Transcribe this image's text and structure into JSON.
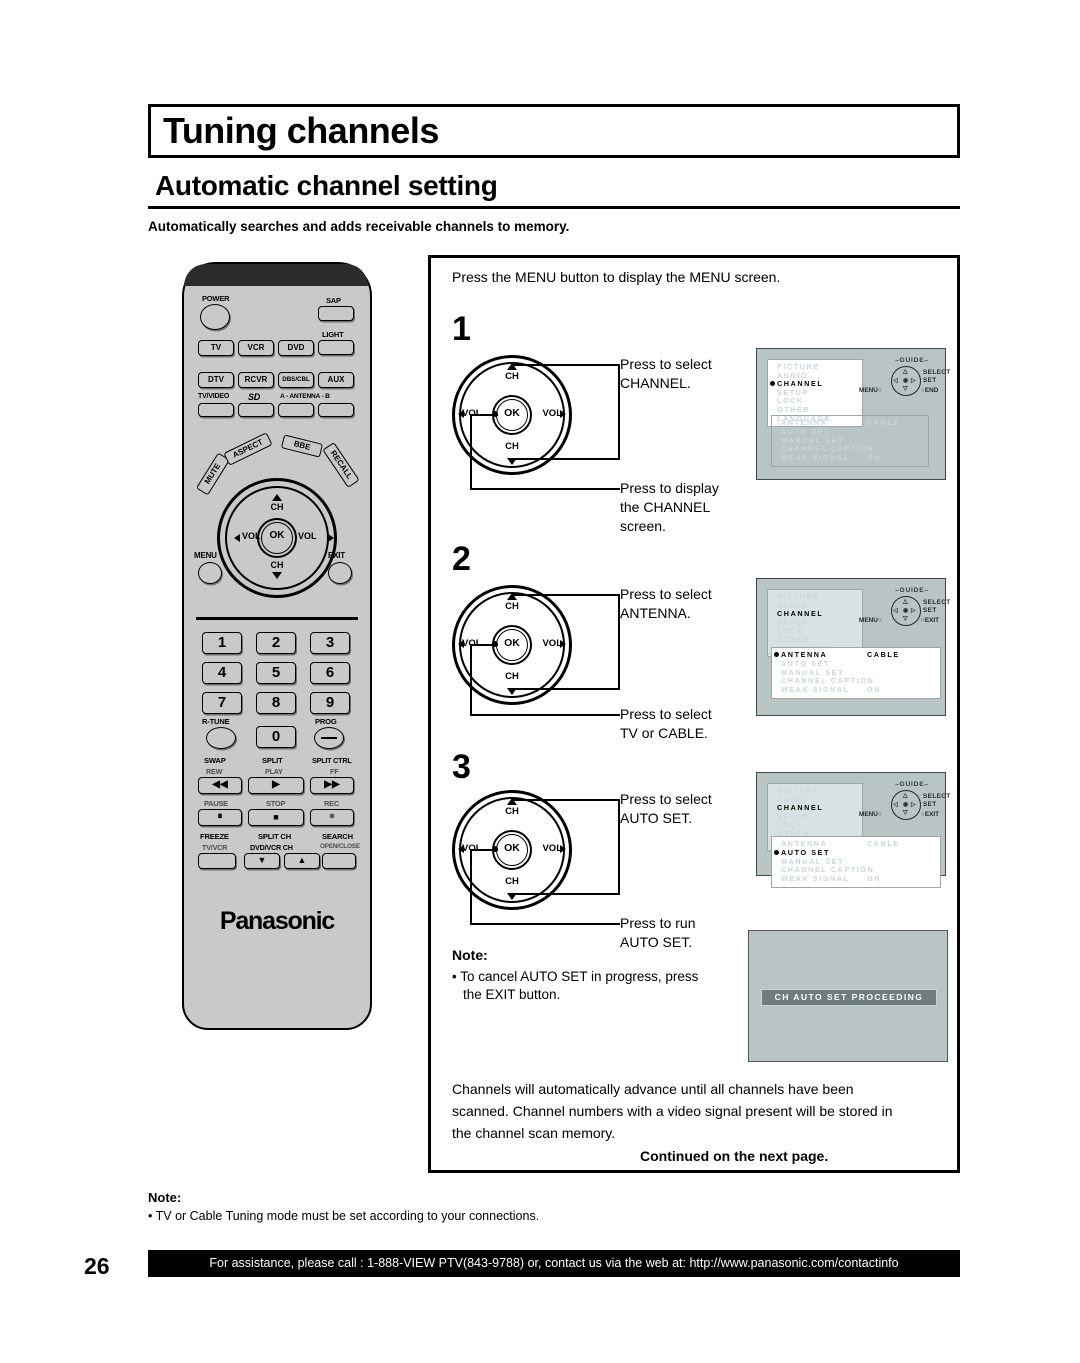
{
  "header": {
    "title": "Tuning channels",
    "subtitle": "Automatic channel setting",
    "intro": "Automatically searches and adds receivable channels to memory."
  },
  "content": {
    "lead": "Press the MENU button to display the MENU screen.",
    "steps": [
      {
        "number": "1",
        "callout_top_line1": "Press to select",
        "callout_top_line2": "CHANNEL.",
        "callout_bottom_line1": "Press to display",
        "callout_bottom_line2": "the CHANNEL",
        "callout_bottom_line3": "screen."
      },
      {
        "number": "2",
        "callout_top_line1": "Press to select",
        "callout_top_line2": "ANTENNA.",
        "callout_bottom_line1": "Press to select",
        "callout_bottom_line2": "TV or CABLE."
      },
      {
        "number": "3",
        "callout_top_line1": "Press to select",
        "callout_top_line2": "AUTO SET.",
        "callout_bottom_line1": "Press to run",
        "callout_bottom_line2": "AUTO SET."
      }
    ],
    "note": {
      "title": "Note:",
      "bullet_line1": "To cancel AUTO SET in progress, press",
      "bullet_line2": "the EXIT button."
    },
    "closing_line1": "Channels will automatically advance until all channels have been",
    "closing_line2": "scanned. Channel numbers with a video signal present will be stored in",
    "closing_line3": "the channel scan memory.",
    "continued": "Continued on the next page."
  },
  "osd": {
    "guide": {
      "header": "–GUIDE–",
      "select": "SELECT",
      "set": "SET",
      "menu": "MENU○",
      "end": "○END",
      "exit": "○EXIT"
    },
    "main_menu": [
      "PICTURE",
      "AUDIO",
      "CHANNEL",
      "SETUP",
      "LOCK",
      "OTHER",
      "LANGUAGE"
    ],
    "submenu": [
      {
        "label": "ANTENNA",
        "value": "CABLE"
      },
      {
        "label": "AUTO SET",
        "value": ""
      },
      {
        "label": "MANUAL SET",
        "value": ""
      },
      {
        "label": "CHANNEL CAPTION",
        "value": ""
      },
      {
        "label": "WEAK SIGNAL",
        "value": "ON"
      }
    ],
    "screens": [
      {
        "selected_main": "CHANNEL",
        "selected_sub": "",
        "guide_right": "○END"
      },
      {
        "selected_main": "CHANNEL",
        "selected_sub": "ANTENNA",
        "guide_right": "○EXIT"
      },
      {
        "selected_main": "CHANNEL",
        "selected_sub": "AUTO SET",
        "guide_right": "○EXIT"
      }
    ],
    "proceeding_message": "CH AUTO SET PROCEEDING"
  },
  "remote": {
    "brand": "Panasonic",
    "power_label": "POWER",
    "sap_label": "SAP",
    "light_label": "LIGHT",
    "device_row1": [
      "TV",
      "VCR",
      "DVD"
    ],
    "device_row2": [
      "DTV",
      "RCVR",
      "DBS/CBL",
      "AUX"
    ],
    "tvvideo_label": "TV/VIDEO",
    "sd_label": "SD",
    "antenna_label": "A - ANTENNA - B",
    "arc_buttons": [
      "MUTE",
      "ASPECT",
      "BBE",
      "RECALL"
    ],
    "dial": {
      "ch_up": "CH",
      "ch_down": "CH",
      "vol_left": "VOL",
      "vol_right": "VOL",
      "ok": "OK"
    },
    "menu_label": "MENU",
    "exit_label": "EXIT",
    "keypad": [
      "1",
      "2",
      "3",
      "4",
      "5",
      "6",
      "7",
      "8",
      "9",
      "0"
    ],
    "rtune_label": "R-TUNE",
    "prog_label": "PROG",
    "transport": {
      "swap": "SWAP",
      "rew": "REW",
      "split": "SPLIT",
      "play": "PLAY",
      "split_ctrl": "SPLIT CTRL",
      "ff": "FF",
      "pause": "PAUSE",
      "stop": "STOP",
      "rec": "REC",
      "freeze": "FREEZE",
      "tvvcr": "TV/VCR",
      "split_ch": "SPLIT CH",
      "dvdvcr_ch": "DVD/VCR CH",
      "search": "SEARCH",
      "openclose": "OPEN/CLOSE"
    }
  },
  "dial_labels": {
    "ch": "CH",
    "vol": "VOL",
    "ok": "OK"
  },
  "footer": {
    "note_title": "Note:",
    "note_bullet": "• TV or Cable Tuning mode must be set according to your connections.",
    "page_number": "26",
    "assistance": "For assistance, please call : 1-888-VIEW PTV(843-9788) or, contact us via the web at: http://www.panasonic.com/contactinfo"
  }
}
